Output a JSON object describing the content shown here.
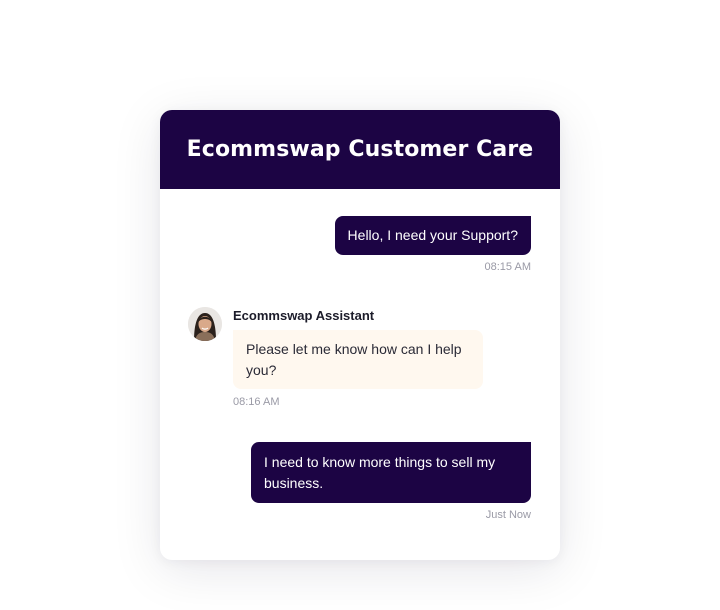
{
  "header": {
    "title": "Ecommswap Customer Care"
  },
  "messages": [
    {
      "from": "user",
      "text": "Hello, I need your Support?",
      "time": "08:15 AM"
    },
    {
      "from": "assistant",
      "sender": "Ecommswap Assistant",
      "avatar_icon": "assistant-avatar",
      "text": "Please let me know how can I help you?",
      "time": "08:16 AM"
    },
    {
      "from": "user",
      "text": "I need to know more things to sell my business.",
      "time": "Just Now"
    }
  ],
  "colors": {
    "brand": "#1c0444",
    "assistant_bubble": "#fff8ef",
    "timestamp": "#9a9aa6"
  }
}
